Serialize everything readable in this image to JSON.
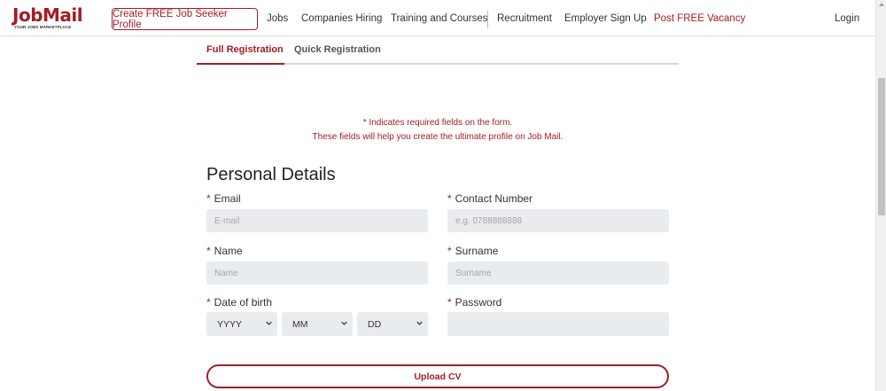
{
  "header": {
    "logo_text_first": "J",
    "logo_text_rest": "obMail",
    "logo_tagline": "YOUR JOBS MARKETPLACE",
    "create_profile_label": "Create FREE Job Seeker Profile",
    "nav": {
      "jobs": "Jobs",
      "companies": "Companies Hiring",
      "training": "Training and Courses",
      "recruitment": "Recruitment",
      "employer_signup": "Employer Sign Up",
      "post_vacancy": "Post FREE Vacancy",
      "login": "Login"
    }
  },
  "tabs": {
    "full": "Full Registration",
    "quick": "Quick Registration"
  },
  "info": {
    "line1": "* Indicates required fields on the form.",
    "line2": "These fields will help you create the ultimate profile on Job Mail."
  },
  "form": {
    "section_title": "Personal Details",
    "required_mark": "*",
    "email": {
      "label": "Email",
      "placeholder": "E-mail"
    },
    "contact": {
      "label": "Contact Number",
      "placeholder": "e.g. 0788888888"
    },
    "name": {
      "label": "Name",
      "placeholder": "Name"
    },
    "surname": {
      "label": "Surname",
      "placeholder": "Surname"
    },
    "dob": {
      "label": "Date of birth",
      "year": "YYYY",
      "month": "MM",
      "day": "DD"
    },
    "password": {
      "label": "Password",
      "placeholder": ""
    },
    "upload_cv": "Upload CV"
  },
  "colors": {
    "brand": "#a31d24",
    "input_bg": "#e9ecef"
  }
}
